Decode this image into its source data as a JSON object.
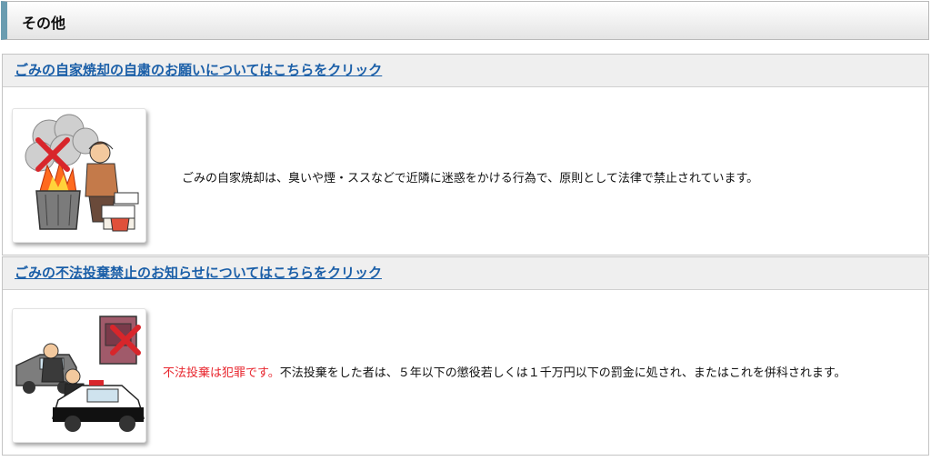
{
  "section": {
    "title": "その他"
  },
  "panels": [
    {
      "link": "ごみの自家焼却の自粛のお願いについてはこちらをクリック",
      "description": "ごみの自家焼却は、臭いや煙・ススなどで近隣に迷惑をかける行為で、原則として法律で禁止されています。"
    },
    {
      "link": "ごみの不法投棄禁止のお知らせについてはこちらをクリック",
      "highlight": "不法投棄は犯罪です。",
      "description": "不法投棄をした者は、５年以下の懲役若しくは１千万円以下の罰金に処され、またはこれを併科されます。"
    }
  ],
  "colors": {
    "link": "#1b5fa8",
    "highlight": "#e8262e",
    "header_accent": "#6a9cb0"
  }
}
